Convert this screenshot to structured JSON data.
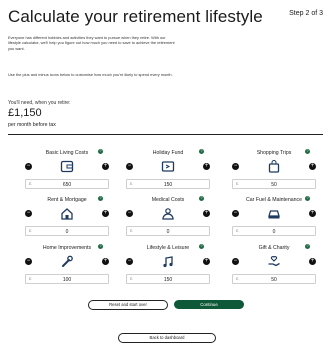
{
  "header": {
    "title": "Calculate your retirement lifestyle",
    "step": "Step 2 of 3"
  },
  "intro": {
    "paragraph1": "Everyone has different hobbies and activities they want to pursue when they retire. With our lifestyle calculator, we'll help you figure out how much you need to save to achieve the retirement you want.",
    "paragraph2": "Use the plus and minus icons below to customise how much you're likely to spend every month."
  },
  "summary": {
    "need_label": "You'll need, when you retire:",
    "amount": "£1,150",
    "period": "per month before tax"
  },
  "colors": {
    "accent": "#1e6a43",
    "button": "#0e5a38"
  },
  "categories": [
    {
      "label": "Basic Living Costs",
      "icon": "wallet-icon",
      "currency": "£",
      "value": "650"
    },
    {
      "label": "Holiday Fund",
      "icon": "ticket-icon",
      "currency": "£",
      "value": "150"
    },
    {
      "label": "Shopping Trips",
      "icon": "shopping-bag-icon",
      "currency": "£",
      "value": "50"
    },
    {
      "label": "Rent & Mortgage",
      "icon": "house-icon",
      "currency": "£",
      "value": "0"
    },
    {
      "label": "Medical Costs",
      "icon": "medical-icon",
      "currency": "£",
      "value": "0"
    },
    {
      "label": "Car Fuel & Maintenance",
      "icon": "car-icon",
      "currency": "£",
      "value": "0"
    },
    {
      "label": "Home Improvements",
      "icon": "wrench-icon",
      "currency": "£",
      "value": "100"
    },
    {
      "label": "Lifestyle & Leisure",
      "icon": "music-icon",
      "currency": "£",
      "value": "150"
    },
    {
      "label": "Gift & Charity",
      "icon": "hand-heart-icon",
      "currency": "£",
      "value": "50"
    }
  ],
  "help_glyph": "?",
  "controls": {
    "minus": "−",
    "plus": "+"
  },
  "actions": {
    "reset": "Reset and start over",
    "continue": "Continue",
    "dashboard": "Back to dashboard"
  }
}
